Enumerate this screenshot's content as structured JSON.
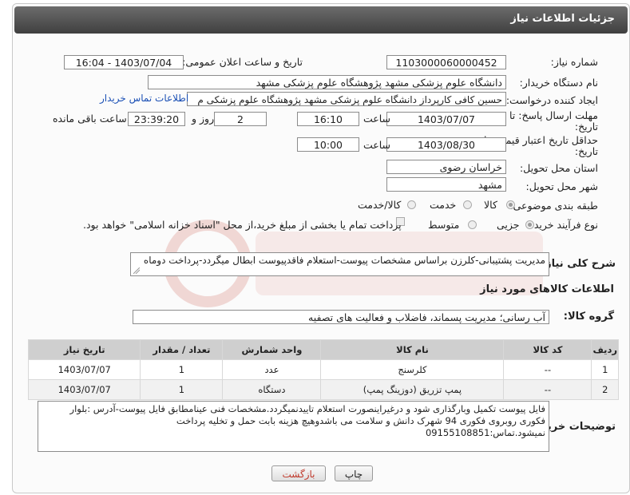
{
  "header": {
    "title": "جزئیات اطلاعات نیاز"
  },
  "fields": {
    "need_number_label": "شماره نیاز:",
    "need_number": "1103000060000452",
    "announce_label": "تاریخ و ساعت اعلان عمومی:",
    "announce_value": "1403/07/04 - 16:04",
    "buyer_org_label": "نام دستگاه خریدار:",
    "buyer_org": "دانشگاه علوم پزشکی مشهد   پژوهشگاه علوم پزشکی مشهد",
    "requester_label": "ایجاد کننده درخواست:",
    "requester": "حسین کافی کارپرداز دانشگاه علوم پزشکی مشهد   پژوهشگاه علوم پزشکی م",
    "contact_link": "اطلاعات تماس خریدار",
    "deadline_label_1": "مهلت ارسال پاسخ: تا",
    "deadline_label_2": "تاریخ:",
    "deadline_date": "1403/07/07",
    "time_label": "ساعت",
    "deadline_time": "16:10",
    "days_value": "2",
    "days_label": "روز و",
    "remaining_time": "23:39:20",
    "remaining_label": "ساعت باقی مانده",
    "validity_label_1": "حداقل تاریخ اعتبار قیمت: تا",
    "validity_label_2": "تاریخ:",
    "validity_date": "1403/08/30",
    "validity_time": "10:00",
    "province_label": "استان محل تحویل:",
    "province": "خراسان رضوی",
    "city_label": "شهر محل تحویل:",
    "city": "مشهد",
    "category_label": "طبقه بندی موضوعی:",
    "cat_goods": "کالا",
    "cat_service": "خدمت",
    "cat_goods_service": "کالا/خدمت",
    "process_label": "نوع فرآیند خرید :",
    "proc_partial": "جزیی",
    "proc_medium": "متوسط",
    "payment_note": "پرداخت تمام یا بخشی از مبلغ خرید،از محل \"اسناد خزانه اسلامی\" خواهد بود."
  },
  "summary": {
    "label": "شرح کلی نیاز:",
    "text": "مدیریت پشتیبانی-کلرزن براساس مشخصات پیوست-استعلام فاقدپیوست ابطال میگردد-پرداخت دوماه"
  },
  "goods_section": {
    "title": "اطلاعات کالاهای مورد نیاز",
    "group_label": "گروه کالا:",
    "group_value": "آب رسانی؛ مدیریت پسماند، فاضلاب و فعالیت های تصفیه"
  },
  "table": {
    "headers": [
      "ردیف",
      "کد کالا",
      "نام کالا",
      "واحد شمارش",
      "تعداد / مقدار",
      "تاریخ نیاز"
    ],
    "rows": [
      [
        "1",
        "--",
        "کلرسنج",
        "عدد",
        "1",
        "1403/07/07"
      ],
      [
        "2",
        "--",
        "پمپ تزریق (دوزینگ پمپ)",
        "دستگاه",
        "1",
        "1403/07/07"
      ]
    ]
  },
  "buyer_notes": {
    "label": "توضیحات خریدار:",
    "line1": "فایل پیوست تکمیل وبارگذاری شود و درغیراینصورت استعلام تاییدنمیگردد.مشخصات فنی عینامطابق فایل پیوست-آدرس :بلوار",
    "line2": "فکوری روبروی فکوری 94 شهرک دانش و سلامت می باشدوهیچ هزینه بابت حمل و تخلیه پرداخت",
    "line3": "نمیشود.تماس:09155108851"
  },
  "buttons": {
    "print": "چاپ",
    "back": "بازگشت"
  },
  "colors": {
    "header_bg": "#4d4d4d",
    "link": "#1a4fb5",
    "back_text": "#c0392b"
  }
}
